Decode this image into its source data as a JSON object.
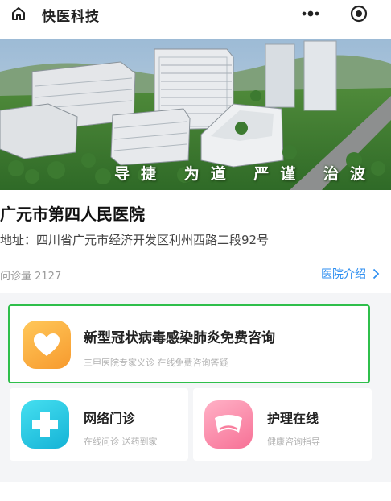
{
  "nav": {
    "title": "快医科技",
    "home_icon": "home-icon",
    "more_icon": "more-dots-icon",
    "close_icon": "target-close-icon"
  },
  "banner": {
    "slogan": "导捷 为道 严谨 治波"
  },
  "hospital": {
    "name": "广元市第四人民医院",
    "address": "地址：四川省广元市经济开发区利州西路二段92号",
    "visit_count": "问诊量 2127",
    "intro_link": "医院介绍"
  },
  "services": {
    "main": {
      "title": "新型冠状病毒感染肺炎免费咨询",
      "subtitle": "三甲医院专家义诊 在线免费咨询答疑",
      "icon": "heart-icon",
      "color": "#f9a53b"
    },
    "items": [
      {
        "title": "网络门诊",
        "desc": "在线问诊 送药到家",
        "icon": "medical-cross-icon",
        "color": "#22bcd8"
      },
      {
        "title": "护理在线",
        "desc": "健康咨询指导",
        "icon": "nurse-cap-icon",
        "color": "#f8809f"
      }
    ]
  },
  "colors": {
    "highlight_border": "#2fbf4b",
    "link": "#2d8ef0"
  }
}
